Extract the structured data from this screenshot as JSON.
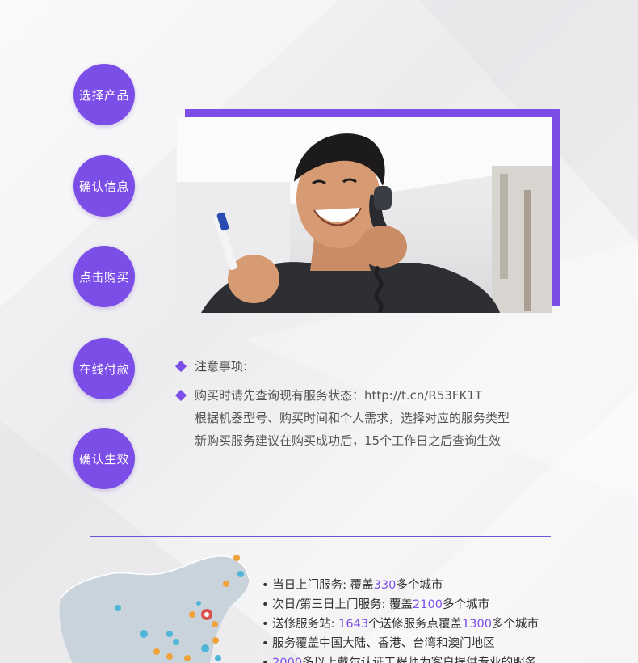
{
  "steps": [
    {
      "label": "选择产品"
    },
    {
      "label": "确认信息"
    },
    {
      "label": "点击购买"
    },
    {
      "label": "在线付款"
    },
    {
      "label": "确认生效"
    }
  ],
  "notice": {
    "title": "注意事项:",
    "line1": "购买时请先查询现有服务状态：http://t.cn/R53FK1T",
    "line2": "根据机器型号、购买时间和个人需求，选择对应的服务类型",
    "line3": "新购买服务建议在购买成功后，15个工作日之后查询生效"
  },
  "stats": {
    "s1_a": "• 当日上门服务: 覆盖",
    "s1_num": "330",
    "s1_b": "多个城市",
    "s2_a": "• 次日/第三日上门服务: 覆盖",
    "s2_num": "2100",
    "s2_b": "多个城市",
    "s3_a": "• 送修服务站: ",
    "s3_num1": "1643",
    "s3_b": "个送修服务点覆盖",
    "s3_num2": "1300",
    "s3_c": "多个城市",
    "s4": "• 服务覆盖中国大陆、香港、台湾和澳门地区",
    "s5_a": "• ",
    "s5_num": "2000",
    "s5_b": "多以上戴尔认证工程师为客户提供专业的服务"
  },
  "colors": {
    "accent": "#7b4ee8",
    "divider": "#6c55d8"
  }
}
